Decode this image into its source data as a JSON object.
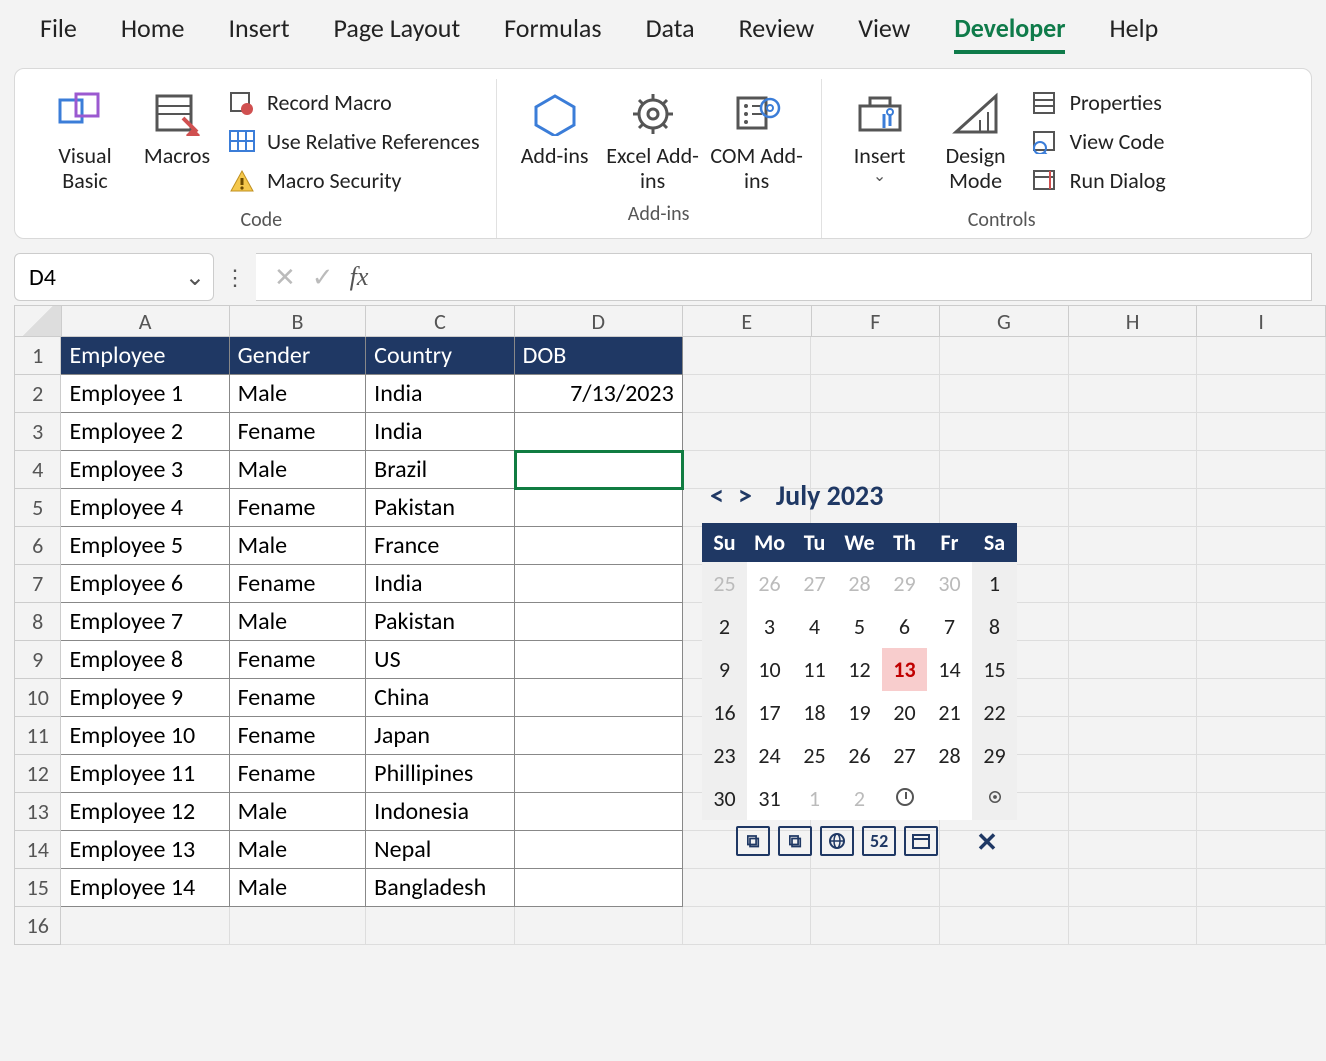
{
  "tabs": [
    "File",
    "Home",
    "Insert",
    "Page Layout",
    "Formulas",
    "Data",
    "Review",
    "View",
    "Developer",
    "Help"
  ],
  "active_tab": "Developer",
  "ribbon": {
    "code": {
      "visual_basic": "Visual Basic",
      "macros": "Macros",
      "record_macro": "Record Macro",
      "use_relative": "Use Relative References",
      "macro_security": "Macro Security",
      "label": "Code"
    },
    "addins": {
      "addins": "Add-ins",
      "excel_addins": "Excel Add-ins",
      "com_addins": "COM Add-ins",
      "label": "Add-ins"
    },
    "controls": {
      "insert": "Insert",
      "design_mode": "Design Mode",
      "properties": "Properties",
      "view_code": "View Code",
      "run_dialog": "Run Dialog",
      "label": "Controls"
    }
  },
  "name_box": "D4",
  "columns": [
    "A",
    "B",
    "C",
    "D",
    "E",
    "F",
    "G",
    "H",
    "I"
  ],
  "row_count": 16,
  "table": {
    "headers": [
      "Employee",
      "Gender",
      "Country",
      "DOB"
    ],
    "rows": [
      [
        "Employee 1",
        "Male",
        "India",
        "7/13/2023"
      ],
      [
        "Employee 2",
        "Fename",
        "India",
        ""
      ],
      [
        "Employee 3",
        "Male",
        "Brazil",
        ""
      ],
      [
        "Employee 4",
        "Fename",
        "Pakistan",
        ""
      ],
      [
        "Employee 5",
        "Male",
        "France",
        ""
      ],
      [
        "Employee 6",
        "Fename",
        "India",
        ""
      ],
      [
        "Employee 7",
        "Male",
        "Pakistan",
        ""
      ],
      [
        "Employee 8",
        "Fename",
        "US",
        ""
      ],
      [
        "Employee 9",
        "Fename",
        "China",
        ""
      ],
      [
        "Employee 10",
        "Fename",
        "Japan",
        ""
      ],
      [
        "Employee 11",
        "Fename",
        "Phillipines",
        ""
      ],
      [
        "Employee 12",
        "Male",
        "Indonesia",
        ""
      ],
      [
        "Employee 13",
        "Male",
        "Nepal",
        ""
      ],
      [
        "Employee 14",
        "Male",
        "Bangladesh",
        ""
      ]
    ]
  },
  "selected_cell": "D4",
  "calendar": {
    "title": "July 2023",
    "day_headers": [
      "Su",
      "Mo",
      "Tu",
      "We",
      "Th",
      "Fr",
      "Sa"
    ],
    "weeks": [
      [
        {
          "n": 25,
          "o": true,
          "w": true
        },
        {
          "n": 26,
          "o": true
        },
        {
          "n": 27,
          "o": true
        },
        {
          "n": 28,
          "o": true
        },
        {
          "n": 29,
          "o": true
        },
        {
          "n": 30,
          "o": true
        },
        {
          "n": 1,
          "w": true
        }
      ],
      [
        {
          "n": 2,
          "w": true
        },
        {
          "n": 3
        },
        {
          "n": 4
        },
        {
          "n": 5
        },
        {
          "n": 6
        },
        {
          "n": 7
        },
        {
          "n": 8,
          "w": true
        }
      ],
      [
        {
          "n": 9,
          "w": true
        },
        {
          "n": 10
        },
        {
          "n": 11
        },
        {
          "n": 12
        },
        {
          "n": 13,
          "sel": true
        },
        {
          "n": 14
        },
        {
          "n": 15,
          "w": true
        }
      ],
      [
        {
          "n": 16,
          "w": true
        },
        {
          "n": 17
        },
        {
          "n": 18
        },
        {
          "n": 19
        },
        {
          "n": 20
        },
        {
          "n": 21
        },
        {
          "n": 22,
          "w": true
        }
      ],
      [
        {
          "n": 23,
          "w": true
        },
        {
          "n": 24
        },
        {
          "n": 25
        },
        {
          "n": 26
        },
        {
          "n": 27
        },
        {
          "n": 28
        },
        {
          "n": 29,
          "w": true
        }
      ],
      [
        {
          "n": 30,
          "w": true
        },
        {
          "n": 31
        },
        {
          "n": 1,
          "o": true
        },
        {
          "n": 2,
          "o": true
        },
        {
          "n": "clock",
          "icon": true
        },
        {
          "n": "",
          "blank": true
        },
        {
          "n": "gear",
          "icon": true,
          "w": true
        }
      ]
    ]
  }
}
